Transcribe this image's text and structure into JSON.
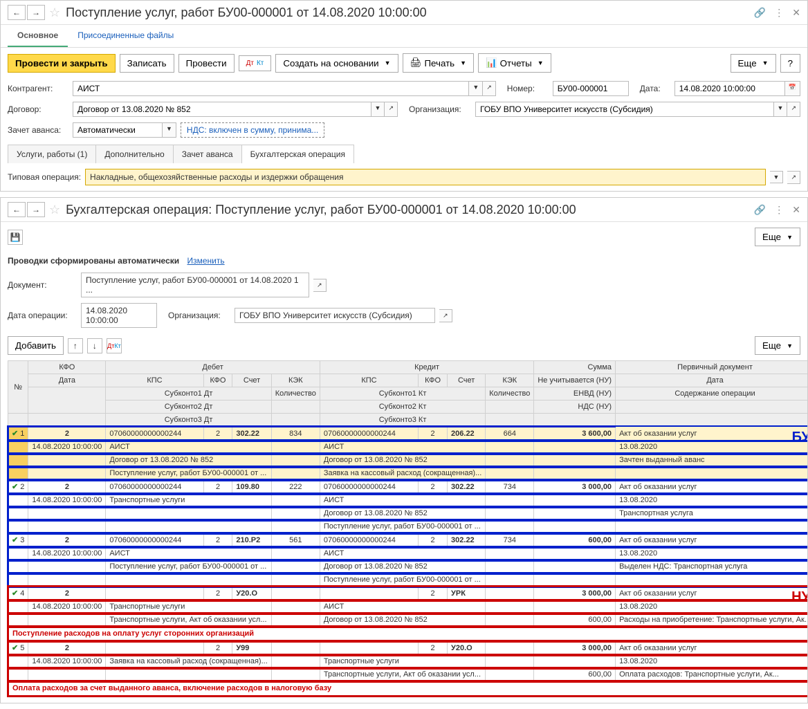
{
  "window1": {
    "title": "Поступление услуг, работ БУ00-000001 от 14.08.2020 10:00:00",
    "main_tabs": {
      "main": "Основное",
      "attached": "Присоединенные файлы"
    },
    "toolbar": {
      "post_close": "Провести и закрыть",
      "save": "Записать",
      "post": "Провести",
      "create_from": "Создать на основании",
      "print": "Печать",
      "reports": "Отчеты",
      "more": "Еще",
      "help": "?"
    },
    "fields": {
      "contractor_lbl": "Контрагент:",
      "contractor_val": "АИСТ",
      "number_lbl": "Номер:",
      "number_val": "БУ00-000001",
      "date_lbl": "Дата:",
      "date_val": "14.08.2020 10:00:00",
      "contract_lbl": "Договор:",
      "contract_val": "Договор от 13.08.2020 № 852",
      "org_lbl": "Организация:",
      "org_val": "ГОБУ ВПО Университет искусств (Субсидия)",
      "prepay_lbl": "Зачет аванса:",
      "prepay_val": "Автоматически",
      "vat_link": "НДС: включен в сумму, принима..."
    },
    "inner_tabs": {
      "services": "Услуги, работы (1)",
      "additional": "Дополнительно",
      "prepay": "Зачет аванса",
      "acc_op": "Бухгалтерская операция"
    },
    "typical_lbl": "Типовая операция:",
    "typical_val": "Накладные, общехозяйственные расходы и издержки обращения"
  },
  "window2": {
    "title": "Бухгалтерская операция: Поступление услуг, работ БУ00-000001 от 14.08.2020 10:00:00",
    "more": "Еще",
    "auto_msg": "Проводки сформированы автоматически",
    "change": "Изменить",
    "doc_lbl": "Документ:",
    "doc_val": "Поступление услуг, работ БУ00-000001 от 14.08.2020 1 ...",
    "opdate_lbl": "Дата операции:",
    "opdate_val": "14.08.2020 10:00:00",
    "org_lbl": "Организация:",
    "org_val": "ГОБУ ВПО Университет искусств (Субсидия)",
    "add_btn": "Добавить"
  },
  "headers": {
    "num": "№",
    "kfo": "КФО",
    "debit": "Дебет",
    "credit": "Кредит",
    "sum": "Сумма",
    "primdoc": "Первичный документ",
    "date": "Дата",
    "kps": "КПС",
    "account": "Счет",
    "kek": "КЭК",
    "not_counted": "Не учитывается (НУ)",
    "qty": "Количество",
    "envd": "ЕНВД (НУ)",
    "content": "Содержание операции",
    "sub1dt": "Субконто1 Дт",
    "sub2dt": "Субконто2 Дт",
    "sub3dt": "Субконто3 Дт",
    "sub1kt": "Субконто1 Кт",
    "sub2kt": "Субконто2 Кт",
    "sub3kt": "Субконто3 Кт",
    "nds": "НДС (НУ)"
  },
  "rows": [
    {
      "n": "1",
      "kfo": "2",
      "date": "14.08.2020 10:00:00",
      "dt_kps": "07060000000000244",
      "dt_kfo": "2",
      "dt_acc": "302.22",
      "dt_kek": "834",
      "dt_s1": "АИСТ",
      "dt_s2": "Договор от 13.08.2020 № 852",
      "dt_s3": "Поступление услуг, работ БУ00-000001 от ...",
      "kt_kps": "07060000000000244",
      "kt_kfo": "2",
      "kt_acc": "206.22",
      "kt_kek": "664",
      "kt_s1": "АИСТ",
      "kt_s2": "Договор от 13.08.2020 № 852",
      "kt_s3": "Заявка на кассовый расход (сокращенная)...",
      "sum": "3 600,00",
      "doc": "Акт об оказании услуг",
      "docdate": "13.08.2020",
      "content": "Зачтен выданный аванс"
    },
    {
      "n": "2",
      "kfo": "2",
      "date": "14.08.2020 10:00:00",
      "dt_kps": "07060000000000244",
      "dt_kfo": "2",
      "dt_acc": "109.80",
      "dt_kek": "222",
      "dt_s1": "Транспортные услуги",
      "dt_s2": "",
      "dt_s3": "",
      "kt_kps": "07060000000000244",
      "kt_kfo": "2",
      "kt_acc": "302.22",
      "kt_kek": "734",
      "kt_s1": "АИСТ",
      "kt_s2": "Договор от 13.08.2020 № 852",
      "kt_s3": "Поступление услуг, работ БУ00-000001 от ...",
      "sum": "3 000,00",
      "doc": "Акт об оказании услуг",
      "docdate": "13.08.2020",
      "content": "Транспортная услуга"
    },
    {
      "n": "3",
      "kfo": "2",
      "date": "14.08.2020 10:00:00",
      "dt_kps": "07060000000000244",
      "dt_kfo": "2",
      "dt_acc": "210.Р2",
      "dt_kek": "561",
      "dt_s1": "АИСТ",
      "dt_s2": "Поступление услуг, работ БУ00-000001 от ...",
      "dt_s3": "",
      "kt_kps": "07060000000000244",
      "kt_kfo": "2",
      "kt_acc": "302.22",
      "kt_kek": "734",
      "kt_s1": "АИСТ",
      "kt_s2": "Договор от 13.08.2020 № 852",
      "kt_s3": "Поступление услуг, работ БУ00-000001 от ...",
      "sum": "600,00",
      "doc": "Акт об оказании услуг",
      "docdate": "13.08.2020",
      "content": "Выделен НДС: Транспортная услуга"
    },
    {
      "n": "4",
      "kfo": "2",
      "date": "14.08.2020 10:00:00",
      "dt_kps": "",
      "dt_kfo": "2",
      "dt_acc": "У20.О",
      "dt_kek": "",
      "dt_s1": "Транспортные услуги",
      "dt_s2": "Транспортные услуги, Акт об оказании усл...",
      "dt_s3": "",
      "kt_kps": "",
      "kt_kfo": "2",
      "kt_acc": "УРК",
      "kt_kek": "",
      "kt_s1": "АИСТ",
      "kt_s2": "Договор от 13.08.2020 № 852",
      "kt_s3": "",
      "sum": "3 000,00",
      "sum2": "600,00",
      "doc": "Акт об оказании услуг",
      "docdate": "13.08.2020",
      "content": "Расходы на приобретение: Транспортные услуги, Ак..."
    },
    {
      "n": "5",
      "kfo": "2",
      "date": "14.08.2020 10:00:00",
      "dt_kps": "",
      "dt_kfo": "2",
      "dt_acc": "У99",
      "dt_kek": "",
      "dt_s1": "Заявка на кассовый расход (сокращенная)...",
      "dt_s2": "",
      "dt_s3": "",
      "kt_kps": "",
      "kt_kfo": "2",
      "kt_acc": "У20.О",
      "kt_kek": "",
      "kt_s1": "Транспортные услуги",
      "kt_s2": "Транспортные услуги, Акт об оказании усл...",
      "kt_s3": "",
      "sum": "3 000,00",
      "sum2": "600,00",
      "doc": "Акт об оказании услуг",
      "docdate": "13.08.2020",
      "content": "Оплата расходов: Транспортные услуги, Ак..."
    }
  ],
  "annotations": {
    "bu": "БУ",
    "nu": "НУ",
    "red1": "Поступление расходов на оплату услуг сторонних организаций",
    "red2": "Оплата расходов за счет выданного аванса, включение расходов в налоговую базу"
  }
}
